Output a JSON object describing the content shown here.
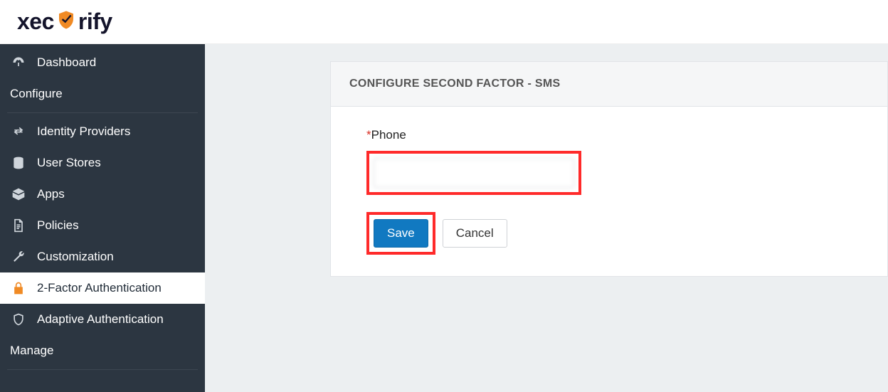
{
  "logo": {
    "text_before": "xec",
    "text_after": "rify"
  },
  "sidebar": {
    "items": [
      {
        "label": "Dashboard"
      }
    ],
    "section_configure": "Configure",
    "configure_items": [
      {
        "label": "Identity Providers"
      },
      {
        "label": "User Stores"
      },
      {
        "label": "Apps"
      },
      {
        "label": "Policies"
      },
      {
        "label": "Customization"
      },
      {
        "label": "2-Factor Authentication"
      },
      {
        "label": "Adaptive Authentication"
      }
    ],
    "section_manage": "Manage"
  },
  "card": {
    "title": "CONFIGURE SECOND FACTOR - SMS",
    "phone_label": "Phone",
    "required_mark": "*",
    "phone_value": "",
    "save_label": "Save",
    "cancel_label": "Cancel"
  }
}
